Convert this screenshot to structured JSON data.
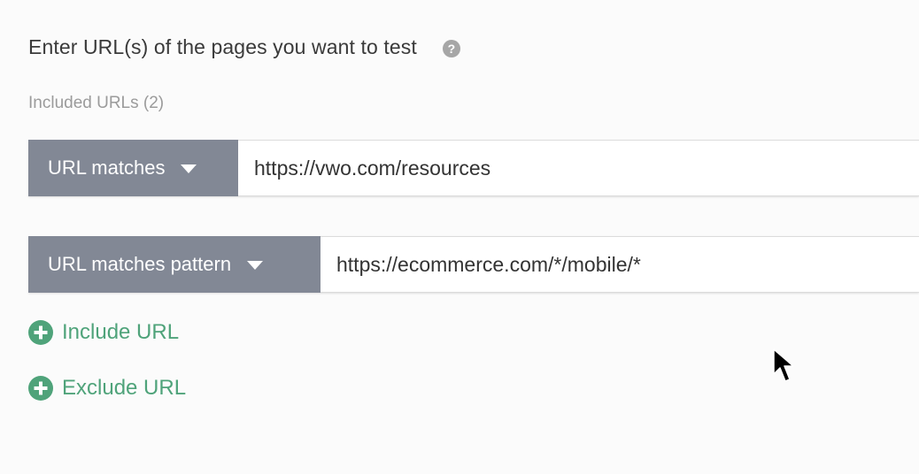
{
  "form": {
    "heading": "Enter URL(s) of the pages you want to test",
    "help_icon": "question-mark-icon",
    "included_label": "Included URLs (2)"
  },
  "rules": [
    {
      "match_type": "URL matches",
      "url": "https://vwo.com/resources"
    },
    {
      "match_type": "URL matches pattern",
      "url": "https://ecommerce.com/*/mobile/*"
    }
  ],
  "actions": {
    "include_label": "Include URL",
    "exclude_label": "Exclude URL",
    "icon": "plus-circle-icon"
  },
  "colors": {
    "accent_green": "#4fa37a",
    "select_bg": "#828895",
    "heading_text": "#3a3a3a",
    "muted_text": "#9b9b9b"
  }
}
